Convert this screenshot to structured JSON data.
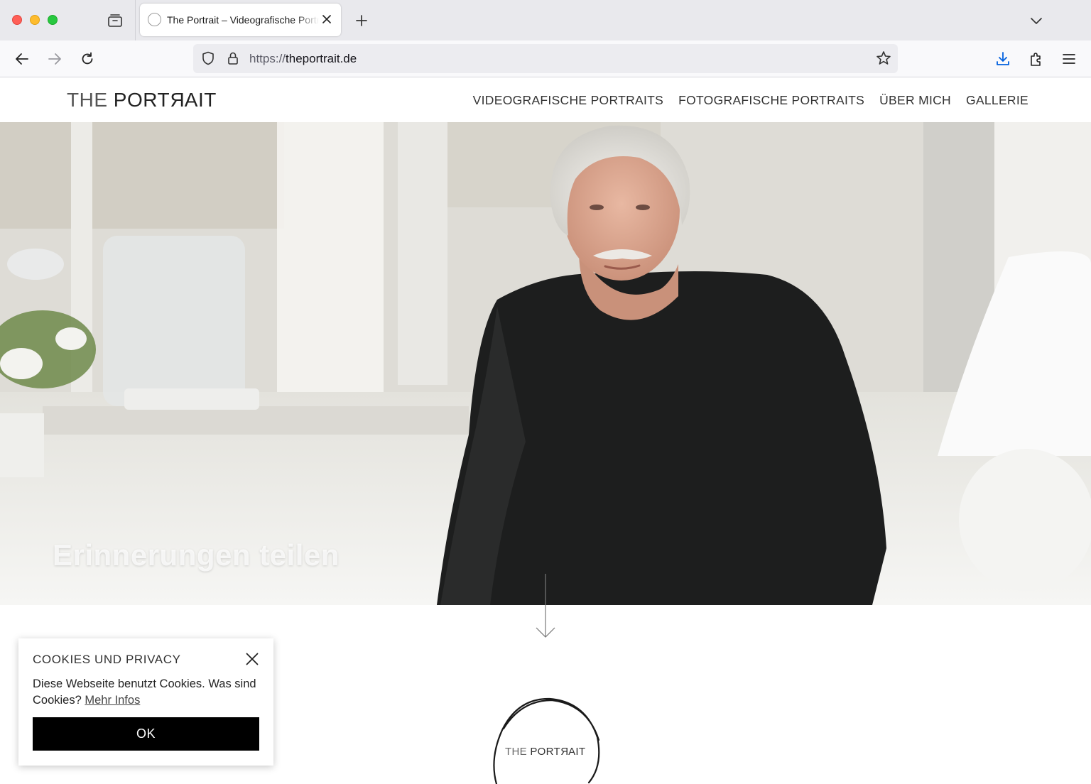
{
  "browser": {
    "tab": {
      "title": "The Portrait – Videografische Portraits"
    },
    "url": {
      "scheme": "https://",
      "host": "theportrait.de"
    },
    "accent_color": "#0060df"
  },
  "site": {
    "logo": {
      "light": "THE ",
      "bold_prefix": "PORT",
      "bold_mirrored": "R",
      "bold_suffix": "AIT"
    },
    "nav": [
      {
        "label": "VIDEOGRAFISCHE PORTRAITS"
      },
      {
        "label": "FOTOGRAFISCHE PORTRAITS"
      },
      {
        "label": "ÜBER MICH"
      },
      {
        "label": "GALLERIE"
      }
    ]
  },
  "hero": {
    "caption": "Erinnerungen teilen"
  },
  "cookie_notice": {
    "title": "COOKIES UND PRIVACY",
    "text": "Diese Webseite benutzt Cookies. Was sind Cookies? ",
    "link_label": "Mehr Infos",
    "ok_label": "OK"
  },
  "bottom_logo": {
    "light": "THE ",
    "bold_prefix": "PORT",
    "bold_mirrored": "R",
    "bold_suffix": "AIT"
  }
}
